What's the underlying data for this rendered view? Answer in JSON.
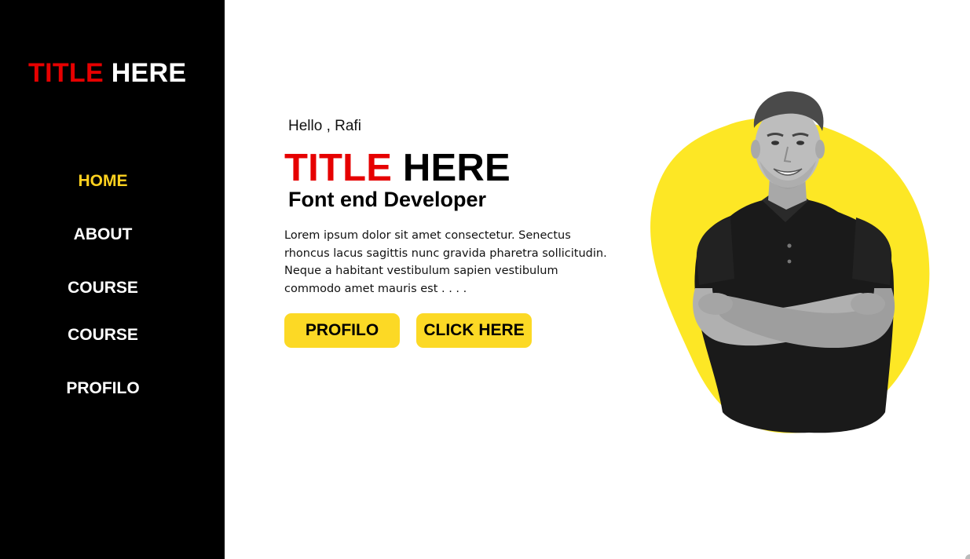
{
  "colors": {
    "accent": "#e60000",
    "highlight": "#ffd21f",
    "button": "#fcd925",
    "sidebar": "#000000"
  },
  "sidebar": {
    "logo": {
      "part1": "TITLE",
      "part2": "HERE"
    },
    "nav": [
      {
        "label": "HOME",
        "active": true
      },
      {
        "label": "ABOUT"
      },
      {
        "label": "COURSE"
      },
      {
        "label": "COURSE"
      },
      {
        "label": "PROFILO"
      }
    ]
  },
  "hero": {
    "greeting": "Hello , Rafi",
    "title": {
      "part1": "TITLE",
      "part2": "HERE"
    },
    "subtitle": "Font end Developer",
    "description": "Lorem ipsum dolor sit amet consectetur. Senectus rhoncus lacus sagittis nunc gravida pharetra sollicitudin. Neque a habitant vestibulum sapien vestibulum commodo amet mauris est . . . .",
    "buttons": {
      "primary": "PROFILO",
      "secondary": "CLICK HERE"
    }
  },
  "image": {
    "subject": "man-portrait",
    "backdrop": "yellow-blob"
  }
}
